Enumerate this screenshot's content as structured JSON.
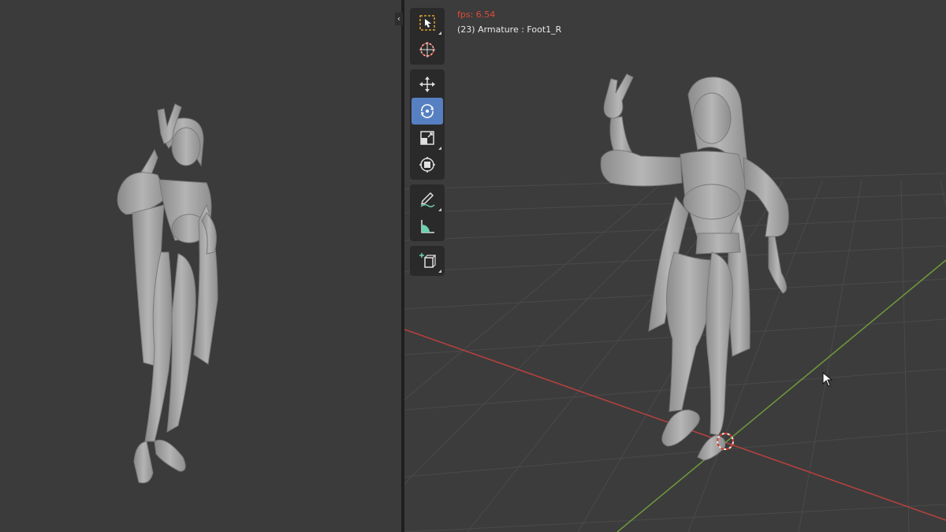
{
  "viewport_right": {
    "overlay": {
      "fps_text": "fps: 6.54",
      "info_text": "(23) Armature : Foot1_R"
    },
    "toolbar": {
      "tools": [
        {
          "name": "select-box",
          "icon": "select-box-icon",
          "active": false
        },
        {
          "name": "cursor",
          "icon": "3d-cursor-icon",
          "active": false
        },
        {
          "name": "move",
          "icon": "move-icon",
          "active": false
        },
        {
          "name": "rotate",
          "icon": "rotate-icon",
          "active": true
        },
        {
          "name": "scale",
          "icon": "scale-icon",
          "active": false
        },
        {
          "name": "transform",
          "icon": "transform-icon",
          "active": false
        },
        {
          "name": "annotate",
          "icon": "annotate-icon",
          "active": false
        },
        {
          "name": "measure",
          "icon": "measure-icon",
          "active": false
        },
        {
          "name": "add-cube",
          "icon": "add-cube-icon",
          "active": false
        }
      ]
    }
  },
  "colors": {
    "viewport_bg": "#3c3c3c",
    "grid_line": "#4a4a4a",
    "x_axis": "#b8413f",
    "y_axis": "#6e9a3a",
    "active_tool": "#5680c2",
    "fps_text": "#e04a3a",
    "model": "#a9a9a9"
  }
}
